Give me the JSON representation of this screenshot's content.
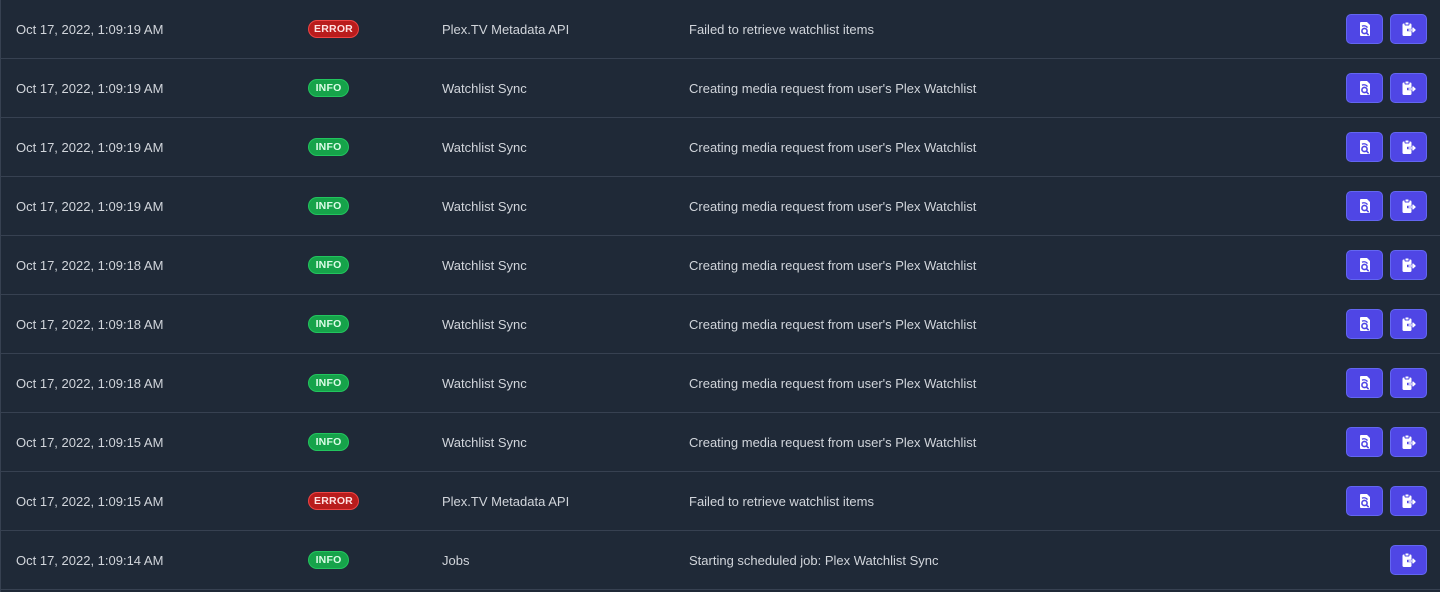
{
  "colors": {
    "background": "#1f2937",
    "row_border": "#374151",
    "text": "#d1d5db",
    "error": "#b91c1c",
    "info": "#16a34a",
    "action_button": "#4f46e5"
  },
  "icons": {
    "details": "document-search-icon",
    "copy": "clipboard-copy-icon"
  },
  "logs": [
    {
      "timestamp": "Oct 17, 2022, 1:09:19 AM",
      "level": "ERROR",
      "label": "Plex.TV Metadata API",
      "message": "Failed to retrieve watchlist items",
      "has_details": true
    },
    {
      "timestamp": "Oct 17, 2022, 1:09:19 AM",
      "level": "INFO",
      "label": "Watchlist Sync",
      "message": "Creating media request from user's Plex Watchlist",
      "has_details": true
    },
    {
      "timestamp": "Oct 17, 2022, 1:09:19 AM",
      "level": "INFO",
      "label": "Watchlist Sync",
      "message": "Creating media request from user's Plex Watchlist",
      "has_details": true
    },
    {
      "timestamp": "Oct 17, 2022, 1:09:19 AM",
      "level": "INFO",
      "label": "Watchlist Sync",
      "message": "Creating media request from user's Plex Watchlist",
      "has_details": true
    },
    {
      "timestamp": "Oct 17, 2022, 1:09:18 AM",
      "level": "INFO",
      "label": "Watchlist Sync",
      "message": "Creating media request from user's Plex Watchlist",
      "has_details": true
    },
    {
      "timestamp": "Oct 17, 2022, 1:09:18 AM",
      "level": "INFO",
      "label": "Watchlist Sync",
      "message": "Creating media request from user's Plex Watchlist",
      "has_details": true
    },
    {
      "timestamp": "Oct 17, 2022, 1:09:18 AM",
      "level": "INFO",
      "label": "Watchlist Sync",
      "message": "Creating media request from user's Plex Watchlist",
      "has_details": true
    },
    {
      "timestamp": "Oct 17, 2022, 1:09:15 AM",
      "level": "INFO",
      "label": "Watchlist Sync",
      "message": "Creating media request from user's Plex Watchlist",
      "has_details": true
    },
    {
      "timestamp": "Oct 17, 2022, 1:09:15 AM",
      "level": "ERROR",
      "label": "Plex.TV Metadata API",
      "message": "Failed to retrieve watchlist items",
      "has_details": true
    },
    {
      "timestamp": "Oct 17, 2022, 1:09:14 AM",
      "level": "INFO",
      "label": "Jobs",
      "message": "Starting scheduled job: Plex Watchlist Sync",
      "has_details": false
    }
  ]
}
